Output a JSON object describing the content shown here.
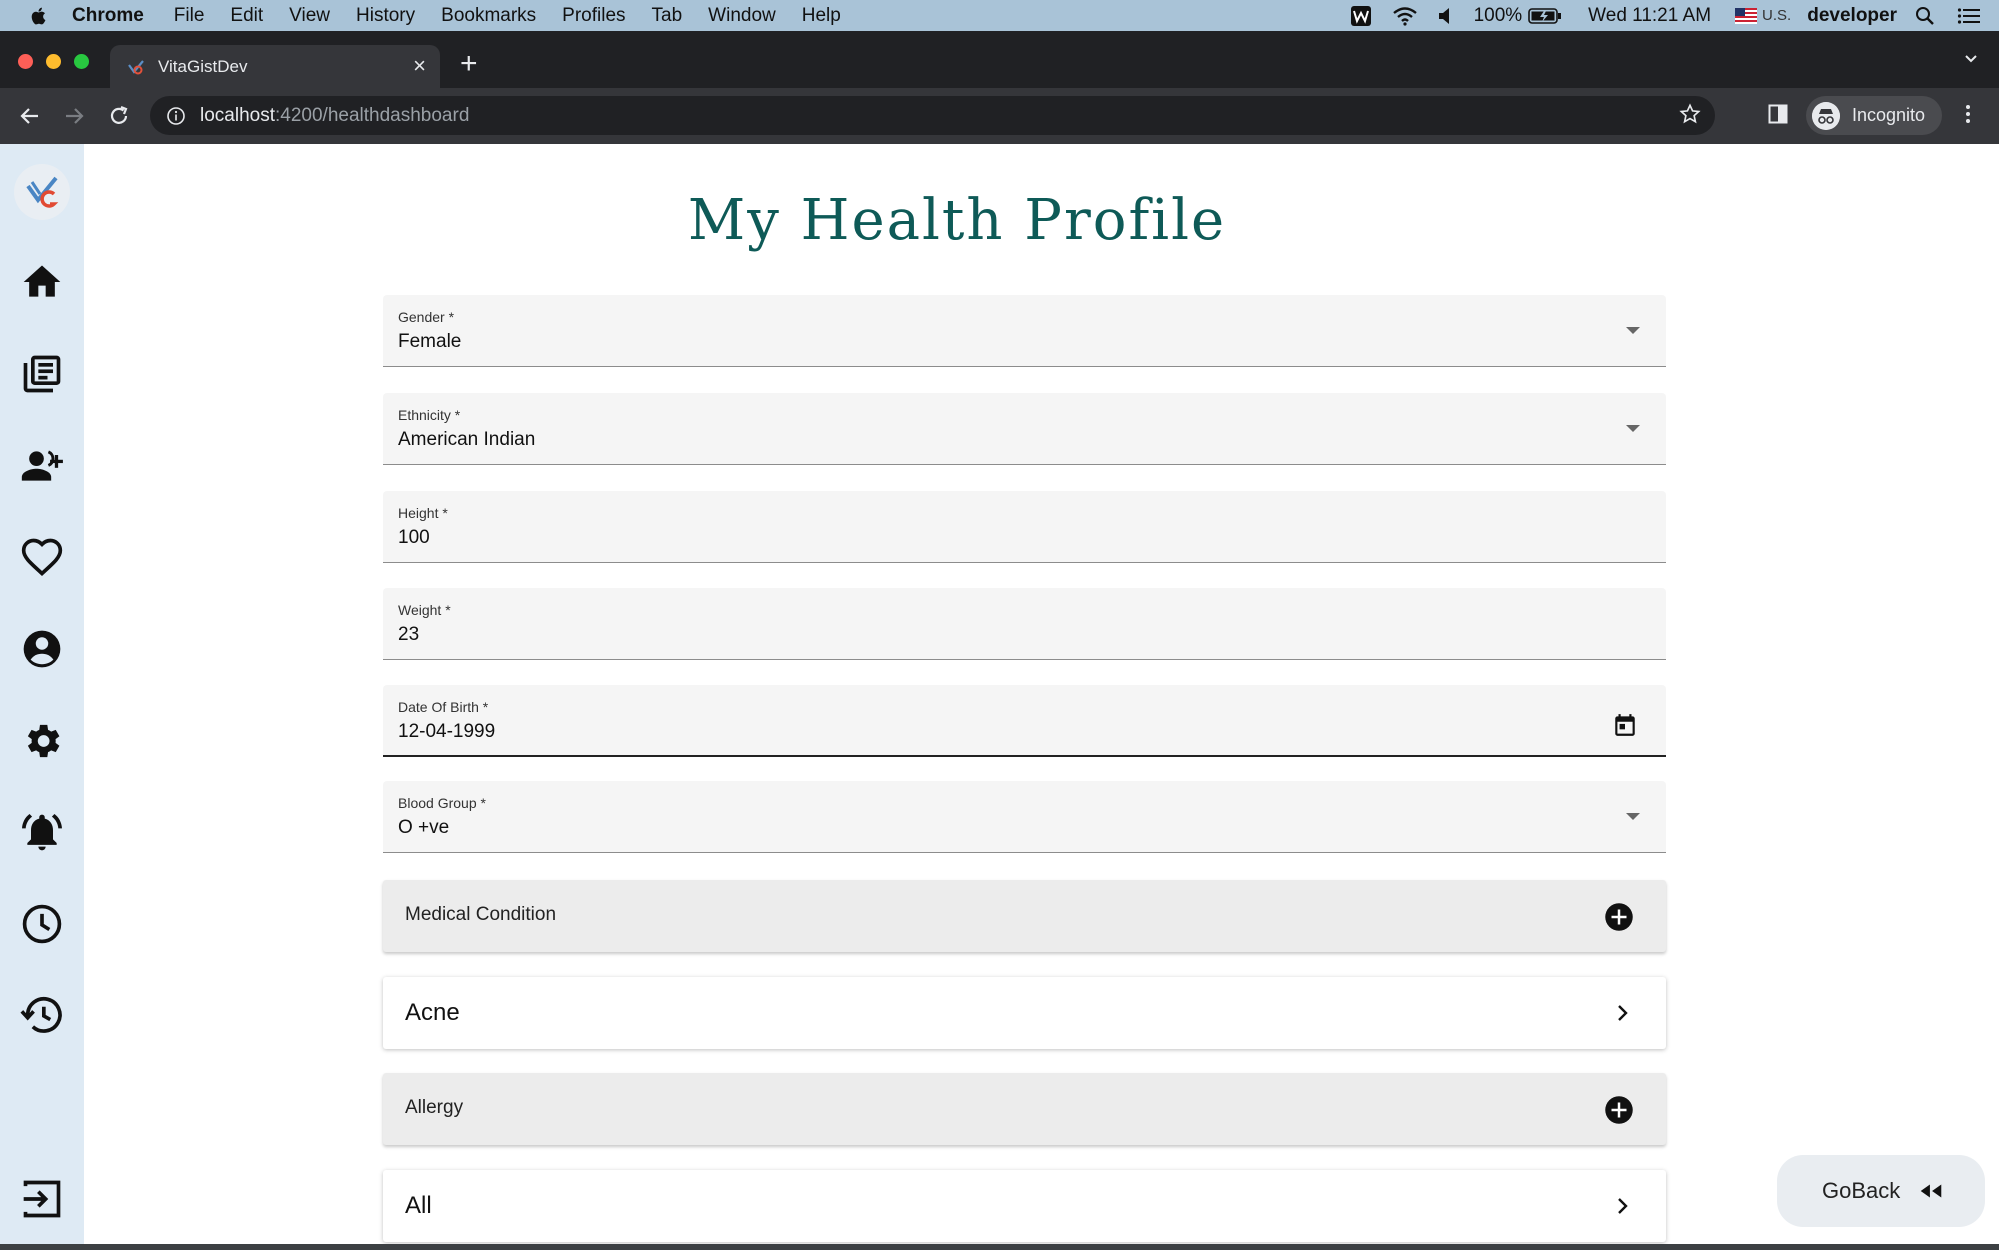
{
  "menubar": {
    "app_name": "Chrome",
    "items": [
      "File",
      "Edit",
      "View",
      "History",
      "Bookmarks",
      "Profiles",
      "Tab",
      "Window",
      "Help"
    ],
    "battery": "100%",
    "clock": "Wed 11:21 AM",
    "input_source": "U.S.",
    "user": "developer"
  },
  "browser": {
    "tab_title": "VitaGistDev",
    "url_host": "localhost",
    "url_path": ":4200/healthdashboard",
    "profile_label": "Incognito"
  },
  "page": {
    "title": "My Health Profile",
    "fields": {
      "gender": {
        "label": "Gender *",
        "value": "Female"
      },
      "ethnicity": {
        "label": "Ethnicity *",
        "value": "American Indian"
      },
      "height": {
        "label": "Height *",
        "value": "100"
      },
      "weight": {
        "label": "Weight *",
        "value": "23"
      },
      "dob": {
        "label": "Date Of Birth *",
        "value": "12-04-1999"
      },
      "blood_group": {
        "label": "Blood Group *",
        "value": "O +ve"
      }
    },
    "sections": {
      "medical_condition": {
        "title": "Medical Condition",
        "items": [
          "Acne"
        ]
      },
      "allergy": {
        "title": "Allergy",
        "items": [
          "All"
        ]
      }
    },
    "goback_label": "GoBack"
  },
  "sidebar_icons": [
    "logo",
    "home-icon",
    "articles-icon",
    "add-user-icon",
    "heart-icon",
    "account-icon",
    "settings-icon",
    "notification-icon",
    "clock-icon",
    "history-icon",
    "logout-icon"
  ],
  "colors": {
    "title": "#0e5a57",
    "sidebar_bg": "#deeaf4",
    "menubar_bg": "#a9c3d7"
  }
}
